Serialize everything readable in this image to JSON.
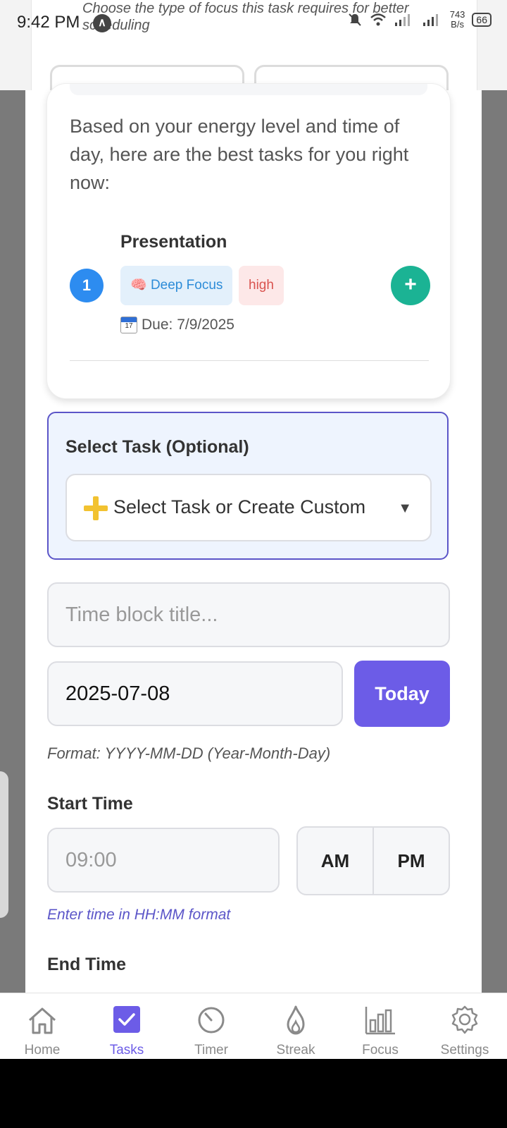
{
  "status_bar": {
    "time": "9:42 PM",
    "speed_value": "743",
    "speed_unit": "B/s",
    "battery": "66"
  },
  "focus_section": {
    "description": "Choose the type of focus this task requires for better scheduling"
  },
  "recommendations": {
    "intro": "Based on your energy level and time of day, here are the best tasks for you right now:",
    "items": [
      {
        "rank": "1",
        "title": "Presentation",
        "focus_icon": "brain",
        "focus_label": "Deep Focus",
        "priority": "high",
        "due": "Due: 7/9/2025"
      }
    ]
  },
  "task_select": {
    "label": "Select Task (Optional)",
    "value": "Select Task or Create Custom"
  },
  "form": {
    "title_placeholder": "Time block title...",
    "date_value": "2025-07-08",
    "today_label": "Today",
    "date_hint": "Format: YYYY-MM-DD (Year-Month-Day)",
    "start_label": "Start Time",
    "start_placeholder": "09:00",
    "am_label": "AM",
    "pm_label": "PM",
    "time_hint": "Enter time in HH:MM format",
    "end_label": "End Time"
  },
  "nav": {
    "items": [
      {
        "label": "Home",
        "icon": "home-icon"
      },
      {
        "label": "Tasks",
        "icon": "checkbox-icon"
      },
      {
        "label": "Timer",
        "icon": "timer-icon"
      },
      {
        "label": "Streak",
        "icon": "flame-icon"
      },
      {
        "label": "Focus",
        "icon": "bar-chart-icon"
      },
      {
        "label": "Settings",
        "icon": "gear-icon"
      }
    ],
    "active_color": "#6c5ce7",
    "inactive_color": "#8a8a8a"
  },
  "colors": {
    "accent": "#6c5ce7",
    "add_button": "#1bb394",
    "rank_badge": "#2d8cf0"
  }
}
